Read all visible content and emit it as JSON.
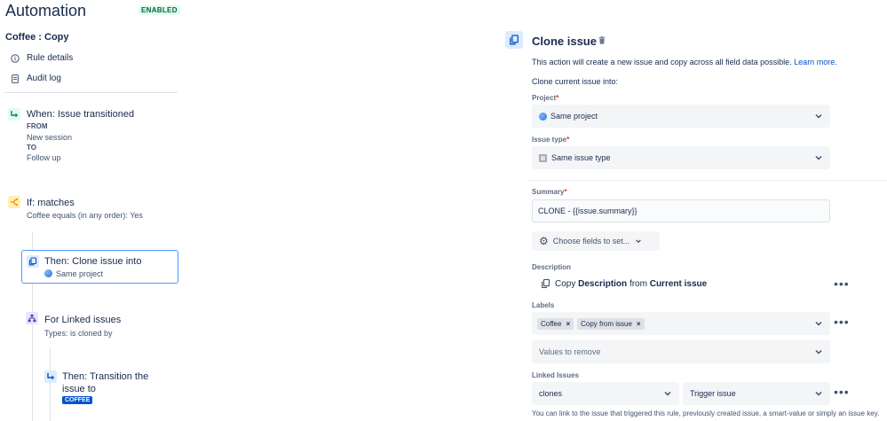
{
  "app": {
    "title": "Automation",
    "status_badge": "ENABLED"
  },
  "rule": {
    "name": "Coffee : Copy"
  },
  "sidebar": {
    "rule_details": "Rule details",
    "audit_log": "Audit log"
  },
  "flow": {
    "trigger": {
      "title": "When: Issue transitioned",
      "from_label": "FROM",
      "from_value": "New session",
      "to_label": "TO",
      "to_value": "Follow up"
    },
    "condition": {
      "title": "If: matches",
      "detail": "Coffee equals (in any order): Yes"
    },
    "action_clone": {
      "title": "Then: Clone issue into",
      "detail": "Same project"
    },
    "branch": {
      "title": "For Linked issues",
      "detail": "Types: is cloned by"
    },
    "action_transition": {
      "title_line1": "Then: Transition the",
      "title_line2": "issue to",
      "status": "COFFEE"
    }
  },
  "panel": {
    "title": "Clone issue",
    "description": "This action will create a new issue and copy across all field data possible.",
    "learn_more": "Learn more.",
    "clone_into": "Clone current issue into:",
    "project": {
      "label": "Project",
      "value": "Same project"
    },
    "issue_type": {
      "label": "Issue type",
      "value": "Same issue type"
    },
    "summary": {
      "label": "Summary",
      "value": "CLONE - {{issue.summary}}"
    },
    "choose_fields": "Choose fields to set...",
    "description_field": {
      "label": "Description",
      "copy_prefix": "Copy",
      "copy_field": "Description",
      "copy_mid": "from",
      "copy_source": "Current issue"
    },
    "labels": {
      "label": "Labels",
      "tags": [
        "Coffee",
        "Copy from issue"
      ],
      "remove_placeholder": "Values to remove"
    },
    "linked_issues": {
      "label": "Linked Issues",
      "link_type": "clones",
      "target": "Trigger issue",
      "note": "You can link to the issue that triggered this rule, previously created issue, a smart-value or simply an issue key."
    },
    "required_marker": "*"
  }
}
